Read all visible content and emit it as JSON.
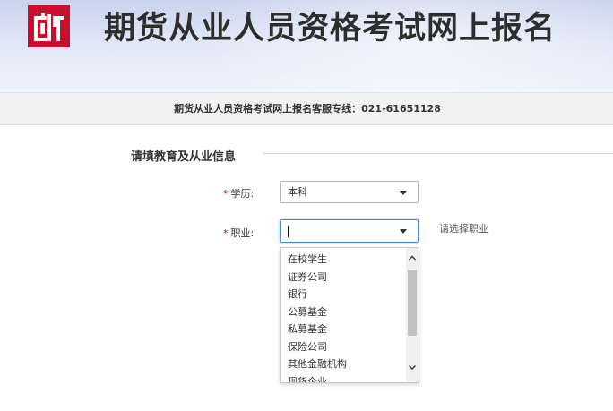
{
  "header": {
    "site_title": "期货从业人员资格考试网上报名",
    "hotline": "期货从业人员资格考试网上报名客服专线：021-61651128"
  },
  "section": {
    "title": "请填教育及从业信息"
  },
  "form": {
    "education": {
      "required_mark": "*",
      "label": "学历:",
      "value": "本科"
    },
    "occupation": {
      "required_mark": "*",
      "label": "职业:",
      "value": "",
      "hint": "请选择职业",
      "options": [
        "在校学生",
        "证券公司",
        "银行",
        "公募基金",
        "私募基金",
        "保险公司",
        "其他金融机构",
        "现货企业"
      ]
    }
  },
  "colors": {
    "brand_red": "#c8102e",
    "required_red": "#d40000",
    "focus_blue": "#4a8cdb"
  },
  "icons": [
    "logo-icon",
    "chevron-down-icon",
    "scroll-up-icon",
    "scroll-down-icon"
  ]
}
